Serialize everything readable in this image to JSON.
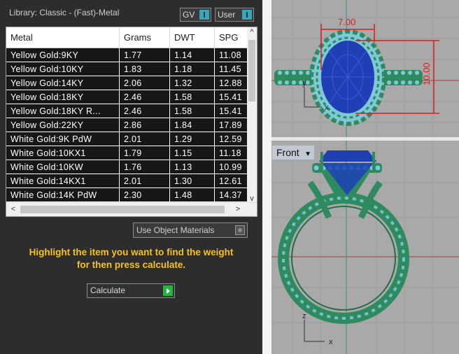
{
  "panel": {
    "library_title": "Library: Classic - (Fast)-Metal",
    "toggle_gv": "GV",
    "toggle_user": "User"
  },
  "table": {
    "headers": [
      "Metal",
      "Grams",
      "DWT",
      "SPG"
    ],
    "rows": [
      [
        "Yellow Gold:9KY",
        "1.77",
        "1.14",
        "11.08"
      ],
      [
        "Yellow Gold:10KY",
        "1.83",
        "1.18",
        "11.45"
      ],
      [
        "Yellow Gold:14KY",
        "2.06",
        "1.32",
        "12.88"
      ],
      [
        "Yellow Gold:18KY",
        "2.46",
        "1.58",
        "15.41"
      ],
      [
        "Yellow Gold:18KY R...",
        "2.46",
        "1.58",
        "15.41"
      ],
      [
        "Yellow Gold:22KY",
        "2.86",
        "1.84",
        "17.89"
      ],
      [
        "White Gold:9K PdW",
        "2.01",
        "1.29",
        "12.59"
      ],
      [
        "White Gold:10KX1",
        "1.79",
        "1.15",
        "11.18"
      ],
      [
        "White Gold:10KW",
        "1.76",
        "1.13",
        "10.99"
      ],
      [
        "White Gold:14KX1",
        "2.01",
        "1.30",
        "12.61"
      ],
      [
        "White Gold:14K PdW",
        "2.30",
        "1.48",
        "14.37"
      ]
    ],
    "scroll_up": "^",
    "scroll_down": "v",
    "scroll_left": "<",
    "scroll_right": ">"
  },
  "options": {
    "use_object_materials": "Use Object Materials"
  },
  "hint": {
    "line1": "Highlight the item you want to find the weight",
    "line2": "for then press calculate."
  },
  "calculate": {
    "label": "Calculate"
  },
  "viewports": {
    "top": {
      "dim_width": "7.00",
      "dim_height": "10.00",
      "axis_y": "y",
      "axis_x": "x"
    },
    "front": {
      "label": "Front",
      "axis_z": "z",
      "axis_x": "x"
    }
  },
  "colors": {
    "viewport_bg": "#a9a9a9",
    "metal_green": "#2f8a5f",
    "gem_blue": "#1f3fb5",
    "prong_cyan": "#7ec8d8",
    "dimension_red": "#e01a1a",
    "hint_yellow": "#f6c21c"
  }
}
